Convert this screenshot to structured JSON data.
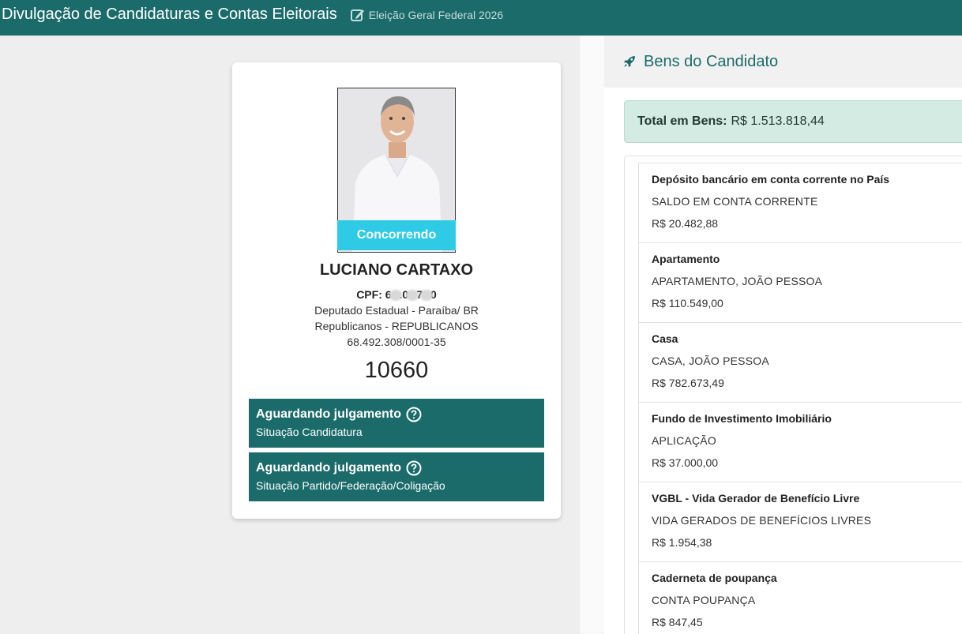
{
  "header": {
    "title": "Divulgação de Candidaturas e Contas Eleitorais",
    "election": "Eleição Geral Federal 2026"
  },
  "candidate": {
    "status_pill": "Concorrendo",
    "name": "LUCIANO CARTAXO",
    "cpf_prefix": "CPF: 6",
    "cpf_mid1": ".0",
    "cpf_mid2": "7",
    "cpf_suffix": "0",
    "office": "Deputado Estadual - Paraíba/ BR",
    "party": "Republicanos - REPUBLICANOS",
    "cnpj": "68.492.308/0001-35",
    "number": "10660",
    "status_candidatura": {
      "title": "Aguardando julgamento",
      "subtitle": "Situação Candidatura"
    },
    "status_partido": {
      "title": "Aguardando julgamento",
      "subtitle": "Situação Partido/Federação/Coligação"
    }
  },
  "assets": {
    "header": "Bens do Candidato",
    "total_label": "Total em Bens:",
    "total_value": "R$ 1.513.818,44",
    "items": [
      {
        "title": "Depósito bancário em conta corrente no País",
        "desc": "SALDO EM CONTA CORRENTE",
        "value": "R$ 20.482,88"
      },
      {
        "title": "Apartamento",
        "desc": "APARTAMENTO, JOÃO PESSOA",
        "value": "R$ 110.549,00"
      },
      {
        "title": "Casa",
        "desc": "CASA, JOÃO PESSOA",
        "value": "R$ 782.673,49"
      },
      {
        "title": "Fundo de Investimento Imobiliário",
        "desc": "APLICAÇÃO",
        "value": "R$ 37.000,00"
      },
      {
        "title": "VGBL - Vida Gerador de Benefício Livre",
        "desc": "VIDA GERADOS DE BENEFÍCIOS LIVRES",
        "value": "R$ 1.954,38"
      },
      {
        "title": "Caderneta de poupança",
        "desc": "CONTA POUPANÇA",
        "value": "R$ 847,45"
      }
    ]
  },
  "colors": {
    "primary": "#1b6b6b",
    "pill": "#2fcbe6",
    "total_bg": "#d4ebe3"
  }
}
